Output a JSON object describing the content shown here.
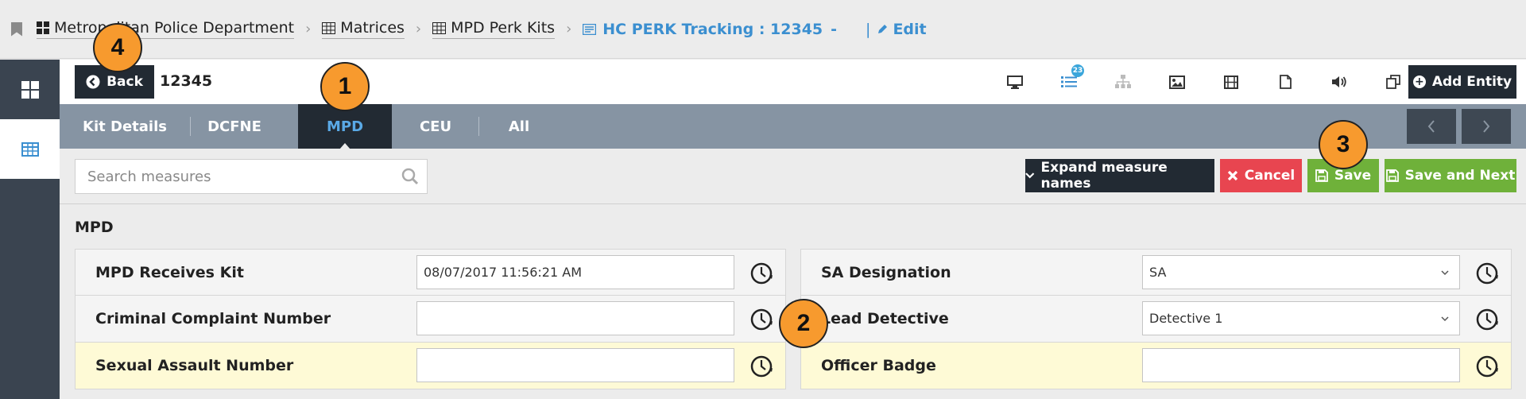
{
  "breadcrumb": {
    "items": [
      {
        "label": "Metropolitan Police Department",
        "icon": "dashboard-icon"
      },
      {
        "label": "Matrices",
        "icon": "table-icon"
      },
      {
        "label": "MPD Perk Kits",
        "icon": "table-icon"
      }
    ],
    "current": "HC PERK Tracking : 12345",
    "dash": "-",
    "pipe": "|",
    "edit_label": "Edit"
  },
  "header": {
    "back_label": "Back",
    "entity_id": "12345",
    "badge_count": "23",
    "add_entity_label": "Add Entity"
  },
  "tabs": [
    {
      "label": "Kit Details",
      "active": false
    },
    {
      "label": "DCFNE",
      "active": false
    },
    {
      "label": "MPD",
      "active": true
    },
    {
      "label": "CEU",
      "active": false
    },
    {
      "label": "All",
      "active": false
    }
  ],
  "search": {
    "placeholder": "Search measures"
  },
  "actions": {
    "expand_label": "Expand measure names",
    "cancel_label": "Cancel",
    "save_label": "Save",
    "save_next_label": "Save and Next"
  },
  "section": {
    "title": "MPD",
    "left_fields": [
      {
        "label": "MPD Receives Kit",
        "value": "08/07/2017 11:56:21 AM",
        "type": "text",
        "highlighted": false
      },
      {
        "label": "Criminal Complaint Number",
        "value": "",
        "type": "text",
        "highlighted": false
      },
      {
        "label": "Sexual Assault Number",
        "value": "",
        "type": "text",
        "highlighted": true
      }
    ],
    "right_fields": [
      {
        "label": "SA Designation",
        "value": "SA",
        "type": "select",
        "highlighted": false
      },
      {
        "label": "Lead Detective",
        "value": "Detective 1",
        "type": "select",
        "highlighted": false
      },
      {
        "label": "Officer Badge",
        "value": "",
        "type": "text",
        "highlighted": true
      }
    ]
  },
  "callouts": [
    "1",
    "2",
    "3",
    "4"
  ],
  "colors": {
    "dark": "#222a33",
    "tabbar": "#8694a3",
    "active_tab_text": "#5aa9e6",
    "link_blue": "#3b8fd0",
    "cancel_red": "#e84550",
    "save_green": "#6fb13a",
    "highlight_row": "#fefad6",
    "callout_orange": "#f79a2e"
  }
}
